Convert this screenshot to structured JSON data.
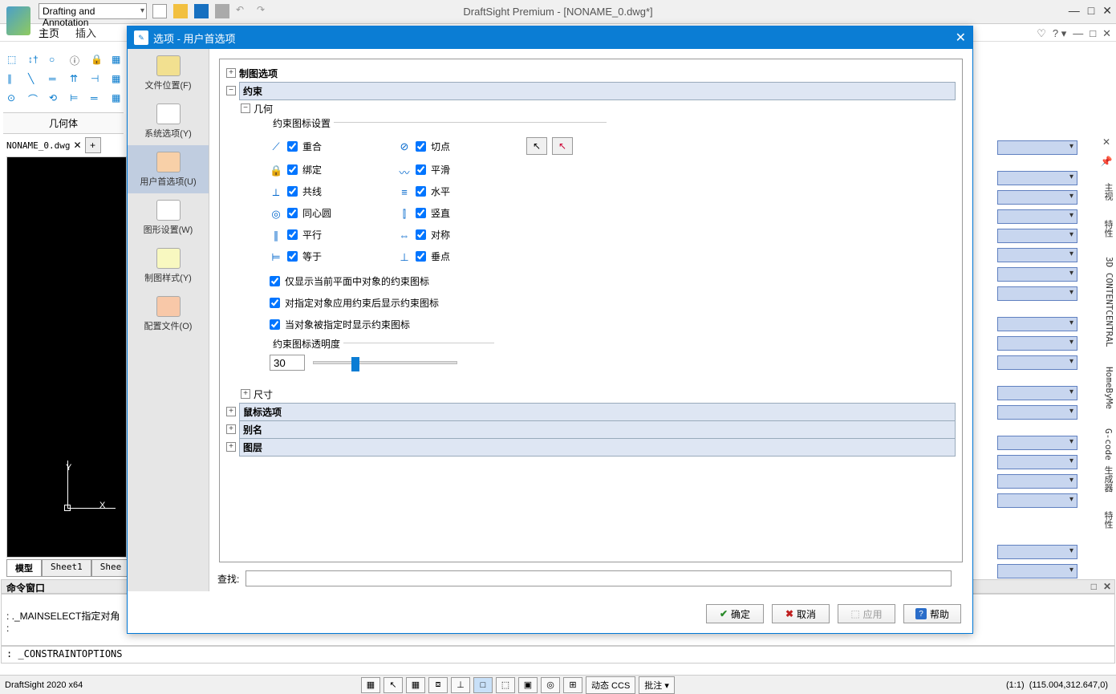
{
  "workspace": "Drafting and Annotation",
  "app_title": "DraftSight Premium - [NONAME_0.dwg*]",
  "maintabs": {
    "home": "主页",
    "insert": "插入"
  },
  "left_panel_title": "几何体",
  "doctab": "NONAME_0.dwg",
  "axis": {
    "y": "Y",
    "x": "X"
  },
  "sheets": {
    "model": "模型",
    "s1": "Sheet1",
    "s2": "Shee"
  },
  "cmd_header": "命令窗口",
  "cmd_line1": ": ._MAINSELECT指定对角",
  "cmd_line2": ":",
  "cmd_input": ": _CONSTRAINTOPTIONS",
  "status_app": "DraftSight 2020 x64",
  "status_dccs": "动态 CCS",
  "status_anno": "批注",
  "status_scale": "(1:1)",
  "status_coord": "(115.004,312.647,0)",
  "spine": {
    "main": "主视",
    "props": "特性",
    "cc": "3D CONTENTCENTRAL",
    "home": "HomeByMe",
    "gcode": "G-code 生成器",
    "props2": "特性"
  },
  "dialog": {
    "title": "选项 - 用户首选项",
    "sidebar": {
      "file": "文件位置(F)",
      "sys": "系统选项(Y)",
      "user": "用户首选项(U)",
      "drawing": "图形设置(W)",
      "style": "制图样式(Y)",
      "profile": "配置文件(O)"
    },
    "tree": {
      "draft_opts": "制图选项",
      "constraint": "约束",
      "geometry": "几何",
      "icon_settings": "约束图标设置",
      "chk": {
        "coincident": "重合",
        "tangent": "切点",
        "fix": "绑定",
        "smooth": "平滑",
        "collinear": "共线",
        "horizontal": "水平",
        "concentric": "同心圆",
        "vertical": "竖直",
        "parallel": "平行",
        "symmetric": "对称",
        "equal": "等于",
        "perpendicular": "垂点"
      },
      "long1": "仅显示当前平面中对象的约束图标",
      "long2": "对指定对象应用约束后显示约束图标",
      "long3": "当对象被指定时显示约束图标",
      "transparency": "约束图标透明度",
      "trans_value": "30",
      "dimension": "尺寸",
      "mouse": "鼠标选项",
      "alias": "别名",
      "layer": "图层"
    },
    "search_label": "查找:",
    "btn_ok": "确定",
    "btn_cancel": "取消",
    "btn_apply": "应用",
    "btn_help": "帮助"
  }
}
